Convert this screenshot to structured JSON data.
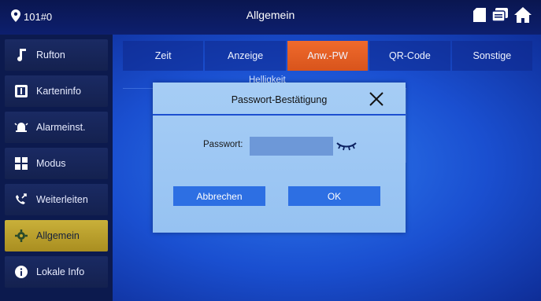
{
  "header": {
    "room": "101#0",
    "title": "Allgemein",
    "icons": [
      "sd-card-icon",
      "messages-icon",
      "home-icon"
    ]
  },
  "sidebar": {
    "items": [
      {
        "label": "Rufton",
        "icon": "music-note-icon"
      },
      {
        "label": "Karteninfo",
        "icon": "card-icon"
      },
      {
        "label": "Alarmeinst.",
        "icon": "alarm-icon"
      },
      {
        "label": "Modus",
        "icon": "mode-icon"
      },
      {
        "label": "Weiterleiten",
        "icon": "forward-call-icon"
      },
      {
        "label": "Allgemein",
        "icon": "gear-icon",
        "active": true
      },
      {
        "label": "Lokale Info",
        "icon": "info-icon"
      }
    ]
  },
  "tabs": [
    {
      "label": "Zeit"
    },
    {
      "label": "Anzeige"
    },
    {
      "label": "Anw.-PW",
      "active": true
    },
    {
      "label": "QR-Code"
    },
    {
      "label": "Sonstige"
    }
  ],
  "background_label": "Helligkeit",
  "dialog": {
    "title": "Passwort-Bestätigung",
    "password_label": "Passwort:",
    "password_value": "",
    "cancel_label": "Abbrechen",
    "ok_label": "OK"
  },
  "colors": {
    "active_tab": "#e8602a",
    "active_sidebar": "#c1a630",
    "dialog_bg": "#a6cdf5",
    "button": "#2d6fe3"
  }
}
